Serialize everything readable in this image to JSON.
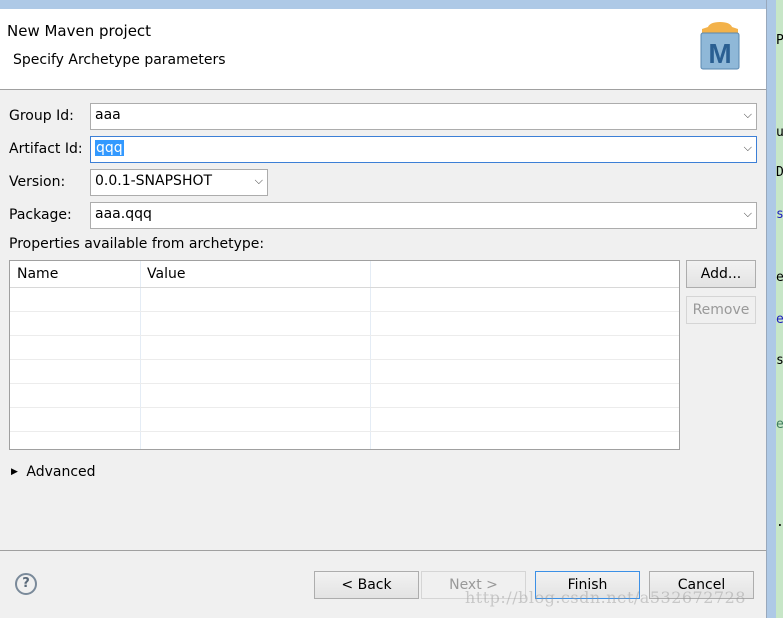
{
  "header": {
    "title": "New Maven project",
    "subtitle": "Specify Archetype parameters",
    "logo_letter": "M"
  },
  "form": {
    "group_id": {
      "label": "Group Id:",
      "value": "aaa"
    },
    "artifact_id": {
      "label": "Artifact Id:",
      "value": "qqq"
    },
    "version": {
      "label": "Version:",
      "value": "0.0.1-SNAPSHOT"
    },
    "package": {
      "label": "Package:",
      "value": "aaa.qqq"
    }
  },
  "properties": {
    "label": "Properties available from archetype:",
    "columns": [
      "Name",
      "Value"
    ],
    "rows": [],
    "add_label": "Add...",
    "remove_label": "Remove"
  },
  "advanced": {
    "label": "Advanced"
  },
  "buttons": {
    "help": "?",
    "back": "< Back",
    "next": "Next >",
    "finish": "Finish",
    "cancel": "Cancel"
  },
  "watermark": "http://blog.csdn.net/a532672728",
  "editor_chars": [
    "P",
    "u",
    "D",
    "s",
    "e",
    "e",
    "s",
    "e",
    "."
  ],
  "colors": {
    "accent": "#3399ff",
    "frame": "#aec9e6",
    "editor_bg": "#c7e6c7"
  }
}
